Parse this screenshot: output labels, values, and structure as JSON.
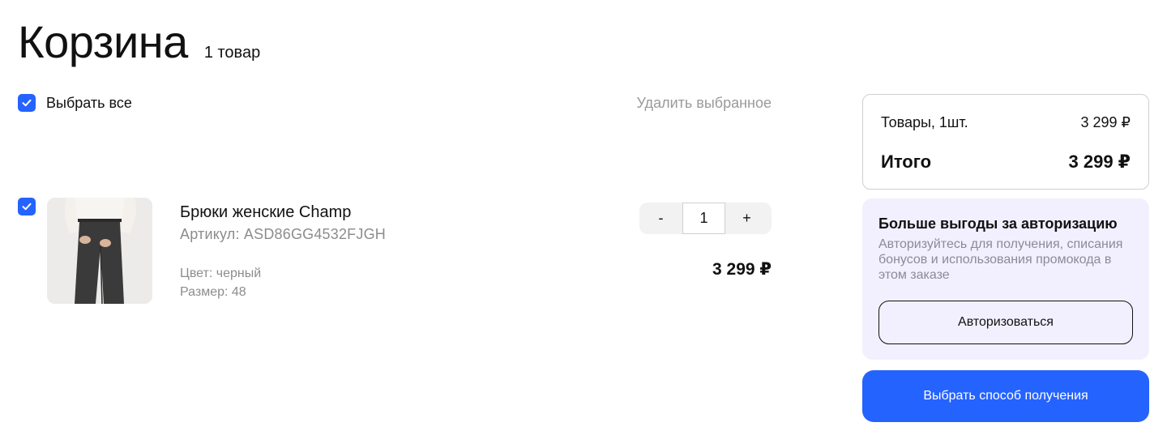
{
  "header": {
    "title": "Корзина",
    "count": "1 товар"
  },
  "toolbar": {
    "select_all_label": "Выбрать все",
    "select_all_checked": true,
    "delete_selected_label": "Удалить выбранное"
  },
  "cart": {
    "items": [
      {
        "checked": true,
        "name": "Брюки женские Champ",
        "sku": "Артикул: ASD86GG4532FJGH",
        "color": "Цвет: черный",
        "size": "Размер: 48",
        "quantity": "1",
        "price": "3 299 ₽",
        "decrement": "-",
        "increment": "+"
      }
    ]
  },
  "summary": {
    "goods_label": "Товары, 1шт.",
    "goods_value": "3 299 ₽",
    "total_label": "Итого",
    "total_value": "3 299 ₽"
  },
  "auth": {
    "title": "Больше выгоды за авторизацию",
    "text": "Авторизуйтесь для получения, списания бонусов и использования промокода в этом заказе",
    "button_label": "Авторизоваться"
  },
  "checkout": {
    "button_label": "Выбрать способ получения"
  },
  "colors": {
    "accent": "#2563ff",
    "auth_bg": "#f2f0fe",
    "muted_text": "#8c8c8c"
  },
  "icons": {
    "checkbox": "check-icon"
  }
}
